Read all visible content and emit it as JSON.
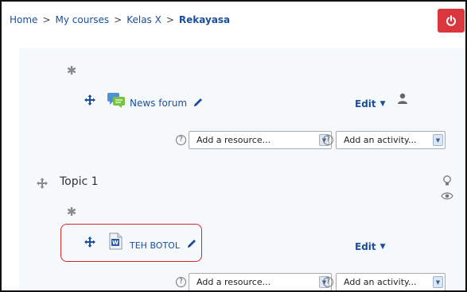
{
  "breadcrumb": {
    "home": "Home",
    "sep": ">",
    "my_courses": "My courses",
    "kelas": "Kelas X",
    "current": "Rekayasa"
  },
  "section0": {
    "forum_link": "News forum",
    "edit_label": "Edit",
    "resource_select": "Add a resource...",
    "activity_select": "Add an activity..."
  },
  "topic1": {
    "title": "Topic 1",
    "file_link": "TEH BOTOL",
    "edit_label": "Edit",
    "resource_select": "Add a resource...",
    "activity_select": "Add an activity..."
  },
  "colors": {
    "link": "#1a4f9c",
    "logout_bg": "#d9363e",
    "highlight": "#d3272e"
  },
  "icons": [
    "gear-icon",
    "move-icon",
    "forum-icon",
    "edit-pencil-icon",
    "caret-down-icon",
    "user-icon",
    "help-icon",
    "word-document-icon",
    "lightbulb-icon",
    "eye-icon",
    "power-icon"
  ]
}
